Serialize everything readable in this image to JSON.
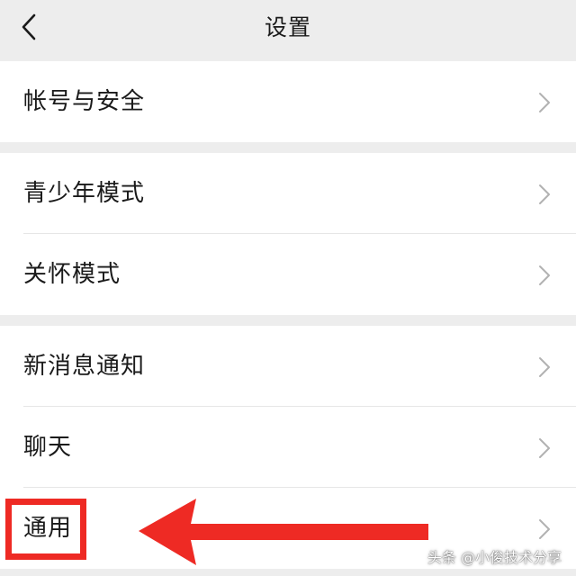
{
  "nav": {
    "title": "设置",
    "back_icon": "chevron-left-icon"
  },
  "groups": [
    {
      "items": [
        {
          "label": "帐号与安全"
        }
      ]
    },
    {
      "items": [
        {
          "label": "青少年模式"
        },
        {
          "label": "关怀模式"
        }
      ]
    },
    {
      "items": [
        {
          "label": "新消息通知"
        },
        {
          "label": "聊天"
        },
        {
          "label": "通用"
        }
      ]
    }
  ],
  "annotation": {
    "highlight_color": "#ee2a24"
  },
  "watermark": "头条 @小俊技术分享",
  "colors": {
    "background": "#ededed",
    "card": "#ffffff",
    "text": "#1a1a1a",
    "chevron": "#b2b2b2"
  }
}
